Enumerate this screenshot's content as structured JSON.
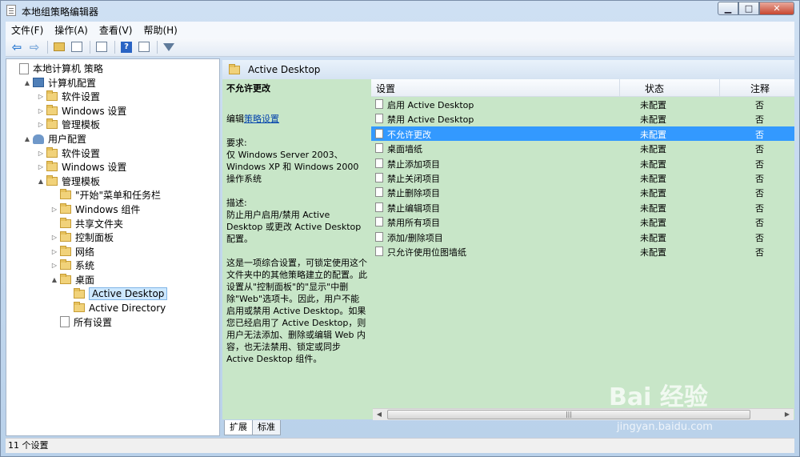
{
  "window": {
    "title": "本地组策略编辑器",
    "controls": {
      "minimize": "▁",
      "maximize": "□",
      "close": "✕"
    }
  },
  "menubar": {
    "items": [
      "文件(F)",
      "操作(A)",
      "查看(V)",
      "帮助(H)"
    ]
  },
  "toolbar": {
    "icons": [
      "back-arrow-icon",
      "forward-arrow-icon",
      "up-folder-icon",
      "show-hide-tree-icon",
      "export-list-icon",
      "help-icon",
      "properties-icon",
      "filter-icon"
    ]
  },
  "tree": {
    "items": [
      {
        "label": "本地计算机 策略",
        "icon": "policy-doc-icon",
        "level": 0,
        "toggle": ""
      },
      {
        "label": "计算机配置",
        "icon": "computer-icon",
        "level": 1,
        "toggle": "▲"
      },
      {
        "label": "软件设置",
        "icon": "folder-icon",
        "level": 2,
        "toggle": "▷"
      },
      {
        "label": "Windows 设置",
        "icon": "folder-icon",
        "level": 2,
        "toggle": "▷"
      },
      {
        "label": "管理模板",
        "icon": "folder-icon",
        "level": 2,
        "toggle": "▷"
      },
      {
        "label": "用户配置",
        "icon": "users-icon",
        "level": 1,
        "toggle": "▲"
      },
      {
        "label": "软件设置",
        "icon": "folder-icon",
        "level": 2,
        "toggle": "▷"
      },
      {
        "label": "Windows 设置",
        "icon": "folder-icon",
        "level": 2,
        "toggle": "▷"
      },
      {
        "label": "管理模板",
        "icon": "folder-icon",
        "level": 2,
        "toggle": "▲"
      },
      {
        "label": "\"开始\"菜单和任务栏",
        "icon": "folder-icon",
        "level": 3,
        "toggle": ""
      },
      {
        "label": "Windows 组件",
        "icon": "folder-icon",
        "level": 3,
        "toggle": "▷"
      },
      {
        "label": "共享文件夹",
        "icon": "folder-icon",
        "level": 3,
        "toggle": ""
      },
      {
        "label": "控制面板",
        "icon": "folder-icon",
        "level": 3,
        "toggle": "▷"
      },
      {
        "label": "网络",
        "icon": "folder-icon",
        "level": 3,
        "toggle": "▷"
      },
      {
        "label": "系统",
        "icon": "folder-icon",
        "level": 3,
        "toggle": "▷"
      },
      {
        "label": "桌面",
        "icon": "folder-icon",
        "level": 3,
        "toggle": "▲"
      },
      {
        "label": "Active Desktop",
        "icon": "folder-icon",
        "level": 4,
        "toggle": "",
        "selected": true
      },
      {
        "label": "Active Directory",
        "icon": "folder-icon",
        "level": 4,
        "toggle": ""
      },
      {
        "label": "所有设置",
        "icon": "all-settings-icon",
        "level": 3,
        "toggle": ""
      }
    ]
  },
  "header": {
    "title": "Active Desktop"
  },
  "description": {
    "title": "不允许更改",
    "edit_prefix": "编辑",
    "edit_link": "策略设置",
    "req_label": "要求:",
    "req_text": "仅 Windows Server 2003、Windows XP 和 Windows 2000 操作系统",
    "desc_label": "描述:",
    "desc_text": "防止用户启用/禁用 Active Desktop 或更改 Active Desktop 配置。",
    "detail_text": "这是一项综合设置，可锁定使用这个文件夹中的其他策略建立的配置。此设置从\"控制面板\"的\"显示\"中删除\"Web\"选项卡。因此，用户不能启用或禁用 Active Desktop。如果您已经启用了 Active Desktop，则用户无法添加、删除或编辑 Web 内容，也无法禁用、锁定或同步 Active Desktop 组件。"
  },
  "table": {
    "columns": [
      "设置",
      "状态",
      "注释"
    ],
    "rows": [
      {
        "name": "启用 Active Desktop",
        "state": "未配置",
        "note": "否"
      },
      {
        "name": "禁用 Active Desktop",
        "state": "未配置",
        "note": "否"
      },
      {
        "name": "不允许更改",
        "state": "未配置",
        "note": "否",
        "selected": true
      },
      {
        "name": "桌面墙纸",
        "state": "未配置",
        "note": "否"
      },
      {
        "name": "禁止添加项目",
        "state": "未配置",
        "note": "否"
      },
      {
        "name": "禁止关闭项目",
        "state": "未配置",
        "note": "否"
      },
      {
        "name": "禁止删除项目",
        "state": "未配置",
        "note": "否"
      },
      {
        "name": "禁止编辑项目",
        "state": "未配置",
        "note": "否"
      },
      {
        "name": "禁用所有项目",
        "state": "未配置",
        "note": "否"
      },
      {
        "name": "添加/删除项目",
        "state": "未配置",
        "note": "否"
      },
      {
        "name": "只允许使用位图墙纸",
        "state": "未配置",
        "note": "否"
      }
    ]
  },
  "tabs": [
    "扩展",
    "标准"
  ],
  "status": {
    "text": "11 个设置"
  },
  "watermark": {
    "main": "Bai 经验",
    "sub": "jingyan.baidu.com"
  }
}
